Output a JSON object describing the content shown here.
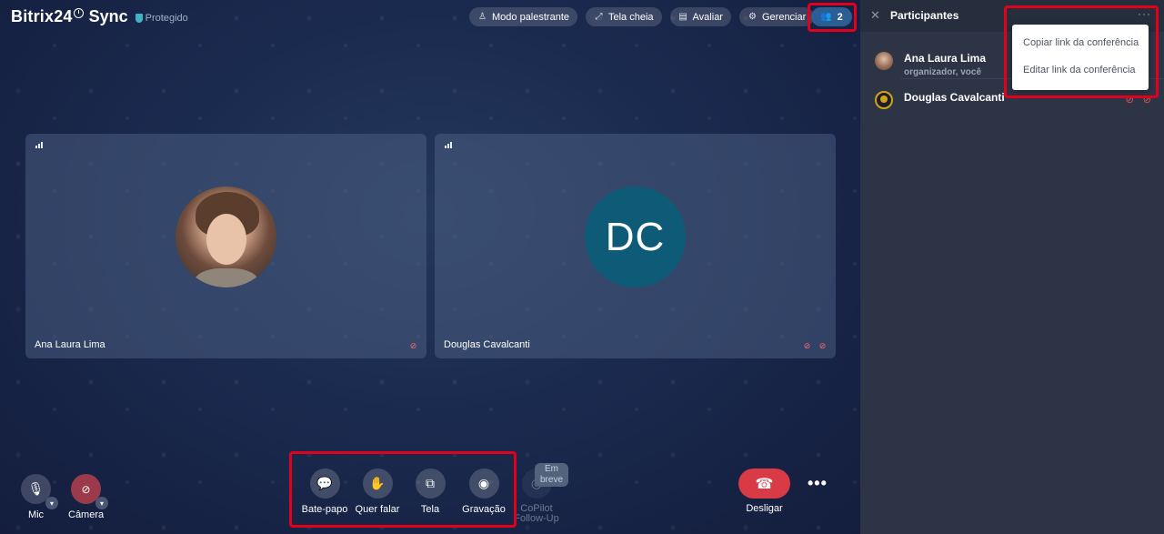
{
  "header": {
    "brand": "Bitrix24",
    "brand_suffix": "Sync",
    "protected_label": "Protegido",
    "actions": [
      {
        "label": "Modo palestrante",
        "icon": "speaker-icon"
      },
      {
        "label": "Tela cheia",
        "icon": "expand-icon"
      },
      {
        "label": "Avaliar",
        "icon": "comment-icon"
      },
      {
        "label": "Gerenciar",
        "icon": "gear-icon"
      }
    ],
    "participants_count": "2"
  },
  "tiles": [
    {
      "name": "Ana Laura Lima"
    },
    {
      "name": "Douglas Cavalcanti",
      "initials": "DC"
    }
  ],
  "controls": {
    "mic": "Mic",
    "camera": "Câmera",
    "chat": "Bate-papo",
    "raise_hand": "Quer falar",
    "screen": "Tela",
    "recording": "Gravação",
    "copilot": "CoPilot\nFollow-Up",
    "copilot_line1": "CoPilot",
    "copilot_line2": "Follow-Up",
    "soon_line1": "Em",
    "soon_line2": "breve",
    "hangup": "Desligar"
  },
  "panel": {
    "title": "Participantes",
    "participants": [
      {
        "name": "Ana Laura Lima",
        "role": "organizador, você"
      },
      {
        "name": "Douglas Cavalcanti"
      }
    ],
    "menu": [
      "Copiar link da conferência",
      "Editar link da conferência"
    ]
  },
  "colors": {
    "highlight": "#e3001b",
    "hangup": "#d83a46",
    "participants_button": "#2c5d93",
    "avatar_dc": "#0e5b78"
  }
}
